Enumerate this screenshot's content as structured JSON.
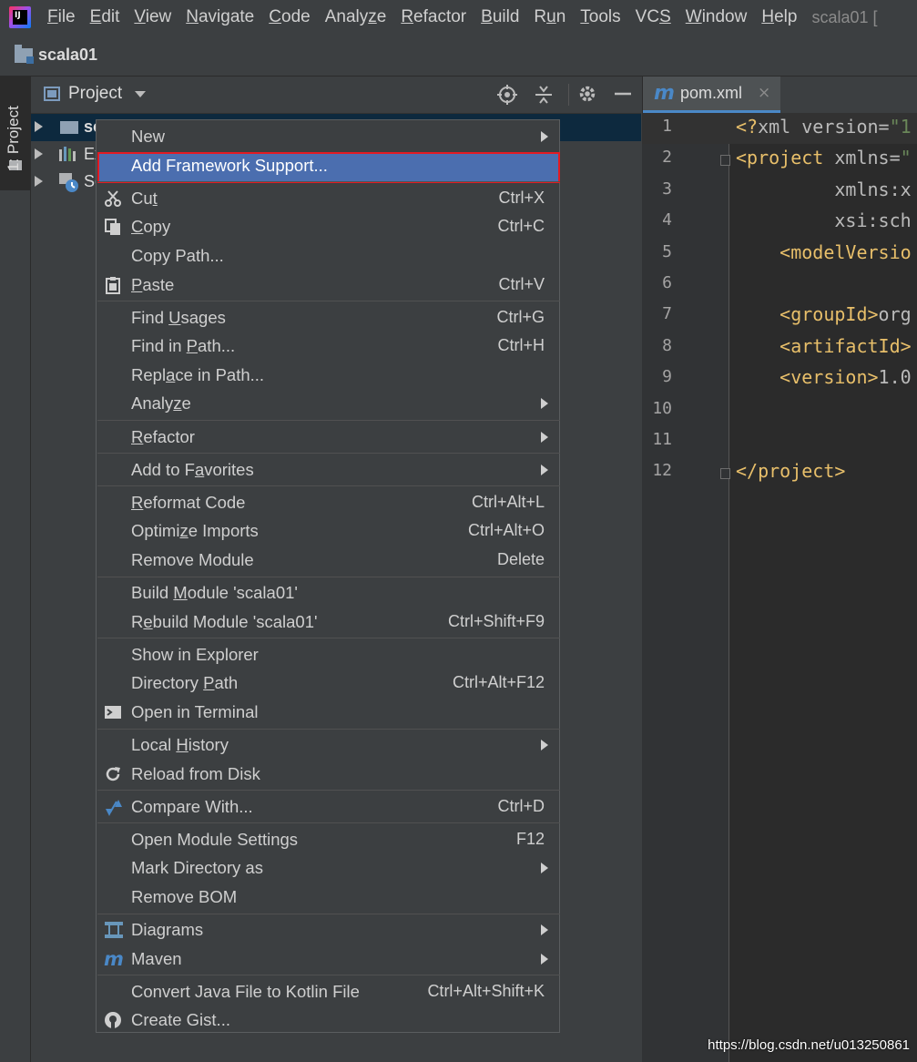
{
  "menubar": {
    "items": [
      {
        "pre": "",
        "u": "F",
        "post": "ile"
      },
      {
        "pre": "",
        "u": "E",
        "post": "dit"
      },
      {
        "pre": "",
        "u": "V",
        "post": "iew"
      },
      {
        "pre": "",
        "u": "N",
        "post": "avigate"
      },
      {
        "pre": "",
        "u": "C",
        "post": "ode"
      },
      {
        "pre": "Analy",
        "u": "z",
        "post": "e"
      },
      {
        "pre": "",
        "u": "R",
        "post": "efactor"
      },
      {
        "pre": "",
        "u": "B",
        "post": "uild"
      },
      {
        "pre": "R",
        "u": "u",
        "post": "n"
      },
      {
        "pre": "",
        "u": "T",
        "post": "ools"
      },
      {
        "pre": "VC",
        "u": "S",
        "post": ""
      },
      {
        "pre": "",
        "u": "W",
        "post": "indow"
      },
      {
        "pre": "",
        "u": "H",
        "post": "elp"
      }
    ],
    "window_title": "scala01 ["
  },
  "breadcrumb": {
    "label": "scala01"
  },
  "tool_stripe": {
    "project_tab": "1: Project"
  },
  "project_panel": {
    "title": "Project",
    "tree": [
      {
        "label": "sc"
      },
      {
        "label": "Ex"
      },
      {
        "label": "Sc"
      }
    ]
  },
  "editor": {
    "tab": {
      "icon_letter": "m",
      "label": "pom.xml",
      "close": "×"
    },
    "line_numbers": [
      "1",
      "2",
      "3",
      "4",
      "5",
      "6",
      "7",
      "8",
      "9",
      "10",
      "11",
      "12"
    ],
    "code_lines": [
      [
        [
          "tag",
          "<?"
        ],
        [
          "attr",
          "xml version="
        ],
        [
          "str",
          "\"1"
        ]
      ],
      [
        [
          "tag",
          "<project "
        ],
        [
          "attr",
          "xmlns="
        ],
        [
          "str",
          "\""
        ]
      ],
      [
        [
          "attr",
          "         xmlns:x"
        ]
      ],
      [
        [
          "attr",
          "         xsi:sch"
        ]
      ],
      [
        [
          "tag",
          "    <modelVersio"
        ]
      ],
      [],
      [
        [
          "tag",
          "    <groupId>"
        ],
        [
          "attr",
          "org"
        ]
      ],
      [
        [
          "tag",
          "    <artifactId>"
        ]
      ],
      [
        [
          "tag",
          "    <version>"
        ],
        [
          "attr",
          "1.0"
        ]
      ],
      [],
      [],
      [
        [
          "tag",
          "</project>"
        ]
      ]
    ]
  },
  "context_menu": {
    "groups": [
      [
        {
          "label": "New",
          "u": "",
          "submenu": true
        },
        {
          "label": "Add Framework Support...",
          "highlighted": true
        }
      ],
      [
        {
          "pre": "Cu",
          "u": "t",
          "post": "",
          "shortcut": "Ctrl+X",
          "icon": "cut-icon"
        },
        {
          "pre": "",
          "u": "C",
          "post": "opy",
          "shortcut": "Ctrl+C",
          "icon": "copy-icon"
        },
        {
          "label": "Copy Path..."
        },
        {
          "pre": "",
          "u": "P",
          "post": "aste",
          "shortcut": "Ctrl+V",
          "icon": "paste-icon"
        }
      ],
      [
        {
          "pre": "Find ",
          "u": "U",
          "post": "sages",
          "shortcut": "Ctrl+G"
        },
        {
          "pre": "Find in ",
          "u": "P",
          "post": "ath...",
          "shortcut": "Ctrl+H"
        },
        {
          "pre": "Repl",
          "u": "a",
          "post": "ce in Path..."
        },
        {
          "pre": "Analy",
          "u": "z",
          "post": "e",
          "submenu": true
        }
      ],
      [
        {
          "pre": "",
          "u": "R",
          "post": "efactor",
          "submenu": true
        }
      ],
      [
        {
          "pre": "Add to F",
          "u": "a",
          "post": "vorites",
          "submenu": true
        }
      ],
      [
        {
          "pre": "",
          "u": "R",
          "post": "eformat Code",
          "shortcut": "Ctrl+Alt+L"
        },
        {
          "pre": "Optimi",
          "u": "z",
          "post": "e Imports",
          "shortcut": "Ctrl+Alt+O"
        },
        {
          "label": "Remove Module",
          "shortcut": "Delete"
        }
      ],
      [
        {
          "pre": "Build ",
          "u": "M",
          "post": "odule 'scala01'"
        },
        {
          "pre": "R",
          "u": "e",
          "post": "build Module 'scala01'",
          "shortcut": "Ctrl+Shift+F9"
        }
      ],
      [
        {
          "label": "Show in Explorer"
        },
        {
          "pre": "Directory ",
          "u": "P",
          "post": "ath",
          "shortcut": "Ctrl+Alt+F12"
        },
        {
          "label": "Open in Terminal",
          "icon": "terminal-icon"
        }
      ],
      [
        {
          "pre": "Local ",
          "u": "H",
          "post": "istory",
          "submenu": true
        },
        {
          "label": "Reload from Disk",
          "icon": "reload-icon"
        }
      ],
      [
        {
          "label": "Compare With...",
          "shortcut": "Ctrl+D",
          "icon": "compare-icon"
        }
      ],
      [
        {
          "label": "Open Module Settings",
          "shortcut": "F12"
        },
        {
          "label": "Mark Directory as",
          "submenu": true
        },
        {
          "label": "Remove BOM"
        }
      ],
      [
        {
          "label": "Diagrams",
          "submenu": true,
          "icon": "diagrams-icon"
        },
        {
          "label": "Maven",
          "submenu": true,
          "icon": "maven-icon"
        }
      ],
      [
        {
          "label": "Convert Java File to Kotlin File",
          "shortcut": "Ctrl+Alt+Shift+K"
        },
        {
          "label": "Create Gist...",
          "icon": "github-icon"
        }
      ]
    ]
  },
  "watermark": "https://blog.csdn.net/u013250861",
  "colors": {
    "accent": "#4b6eaf",
    "highlight_border": "#e31b23",
    "background": "#3c3f41",
    "editor_bg": "#2b2b2b"
  }
}
